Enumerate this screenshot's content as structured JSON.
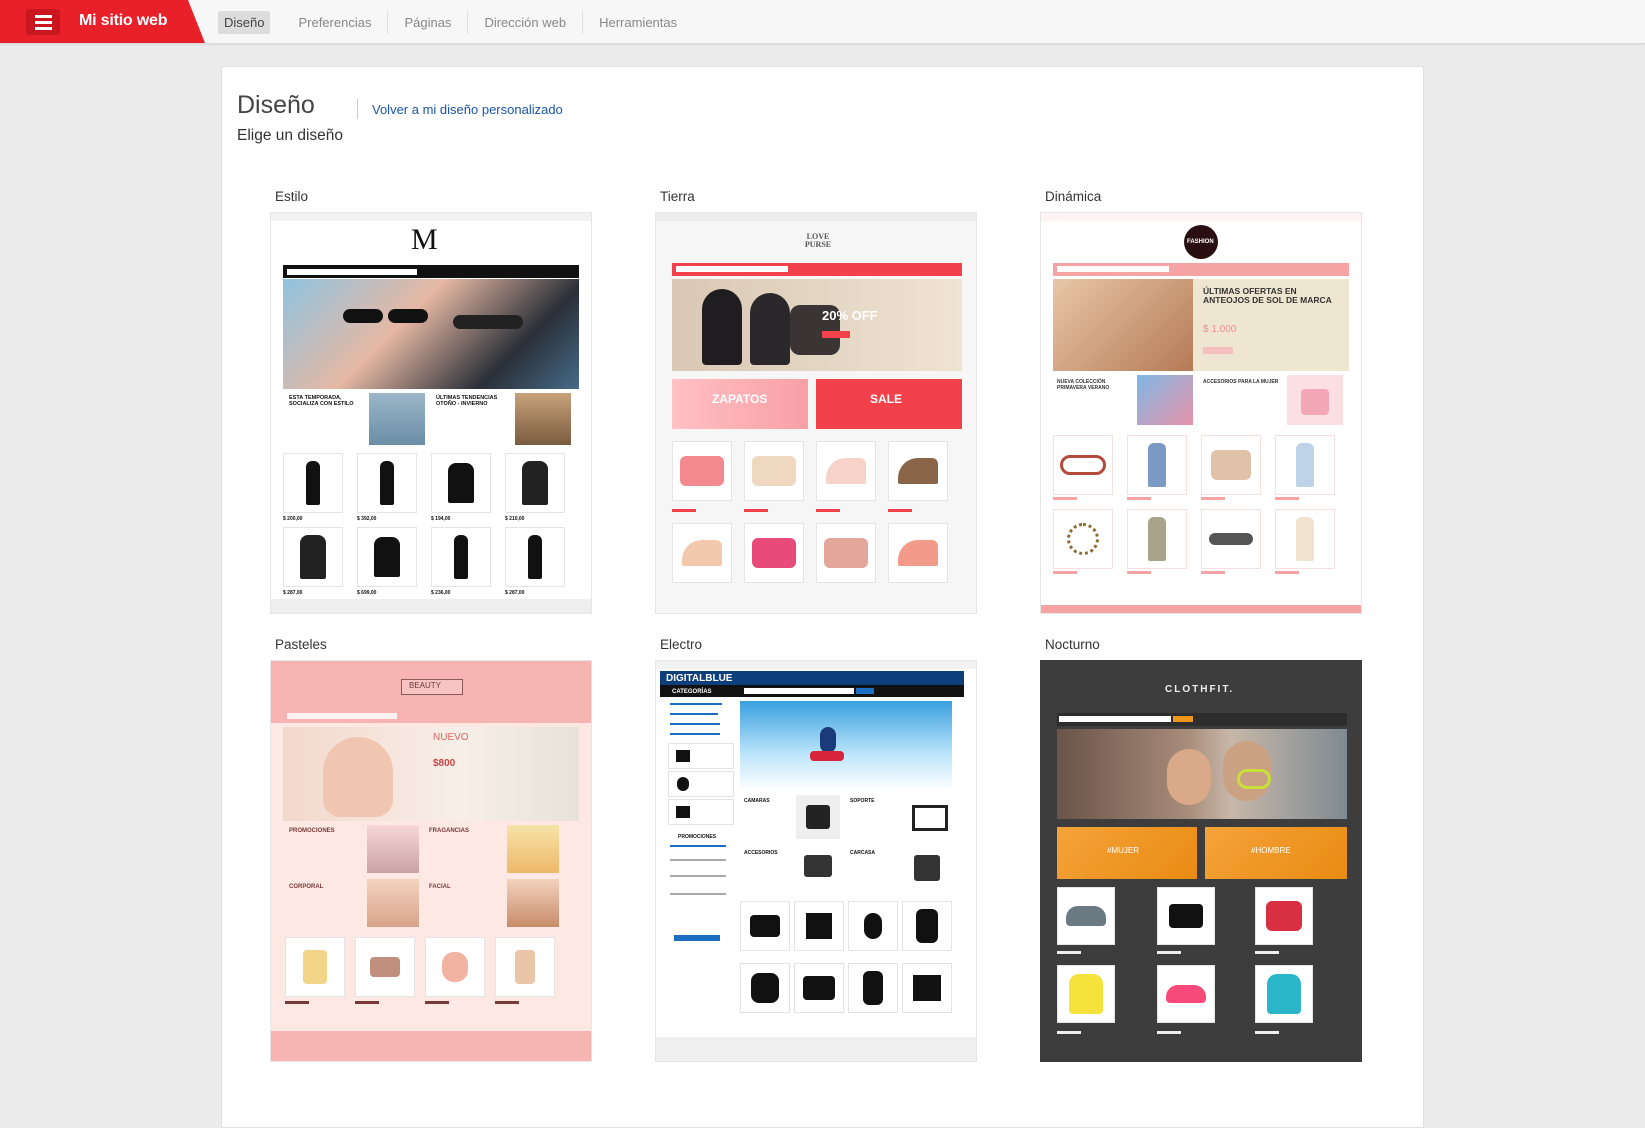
{
  "app": {
    "title": "Mi sitio web",
    "menu_icon": "hamburger-icon"
  },
  "nav": {
    "items": [
      {
        "label": "Diseño",
        "active": true
      },
      {
        "label": "Preferencias",
        "active": false
      },
      {
        "label": "Páginas",
        "active": false
      },
      {
        "label": "Dirección web",
        "active": false
      },
      {
        "label": "Herramientas",
        "active": false
      }
    ]
  },
  "main": {
    "title": "Diseño",
    "back_link": "Volver a mi diseño personalizado",
    "subtitle": "Elige un diseño"
  },
  "themes": [
    {
      "name": "Estilo",
      "accent": "#111111",
      "bg": "#ffffff",
      "logo": "M",
      "blocks": [
        "ESTA TEMPORADA, SOCIALIZA CON ESTILO",
        "ÚLTIMAS TENDENCIAS OTOÑO - INVIERNO"
      ],
      "prices": [
        "$ 200,00",
        "$ 392,00",
        "$ 194,00",
        "$ 210,00",
        "$ 287,00",
        "$ 699,00",
        "$ 236,00",
        "$ 287,00"
      ]
    },
    {
      "name": "Tierra",
      "accent": "#f2414a",
      "bg": "#f6f6f6",
      "logo": "LOVE PURSE",
      "blocks": [
        "20% OFF",
        "ZAPATOS",
        "SALE"
      ]
    },
    {
      "name": "Dinámica",
      "accent": "#f5a3a3",
      "bg": "#ffffff",
      "logo": "FASHION",
      "blocks": [
        "ÚLTIMAS OFERTAS EN ANTEOJOS DE SOL DE MARCA",
        "$ 1.000",
        "NUEVA COLECCIÓN PRIMAVERA VERANO",
        "ACCESORIOS PARA LA MUJER"
      ]
    },
    {
      "name": "Pasteles",
      "accent": "#f8b3b3",
      "bg": "#fde8e3",
      "logo": "BEAUTY",
      "blocks": [
        "NUEVO",
        "$800",
        "PROMOCIONES",
        "FRAGANCIAS",
        "CORPORAL",
        "FACIAL"
      ]
    },
    {
      "name": "Electro",
      "accent": "#0d3f7a",
      "bg": "#ffffff",
      "logo": "DIGITALBLUE",
      "blocks": [
        "CATEGORÍAS",
        "CAMARAS",
        "SOPORTE",
        "ACCESORIOS",
        "CARCASA",
        "PROMOCIONES"
      ]
    },
    {
      "name": "Nocturno",
      "accent": "#f0961d",
      "bg": "#3d3d3d",
      "logo": "CLOTHFIT.",
      "blocks": [
        "#MUJER",
        "#HOMBRE"
      ]
    }
  ]
}
